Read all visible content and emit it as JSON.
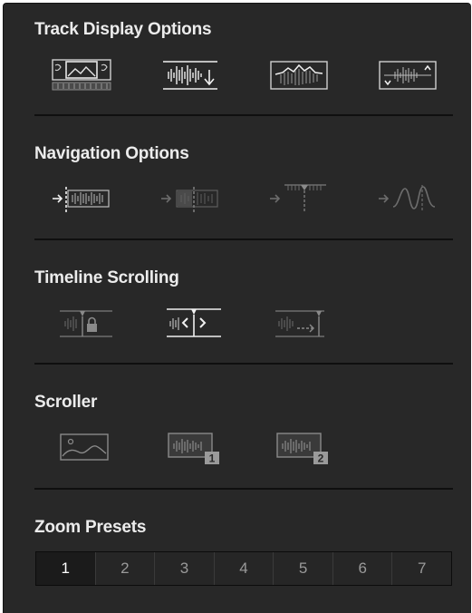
{
  "sections": {
    "track_display": {
      "title": "Track Display Options"
    },
    "navigation": {
      "title": "Navigation Options"
    },
    "timeline_scrolling": {
      "title": "Timeline Scrolling"
    },
    "scroller": {
      "title": "Scroller"
    },
    "zoom_presets": {
      "title": "Zoom Presets"
    }
  },
  "zoom_presets": {
    "selected": "1",
    "buttons": [
      "1",
      "2",
      "3",
      "4",
      "5",
      "6",
      "7"
    ]
  },
  "scroller_badges": [
    "1",
    "2"
  ],
  "colors": {
    "panel_bg": "#282828",
    "title_text": "#ececec",
    "icon_bright": "#e6e6e6",
    "icon_dim": "#6d6d6d",
    "separator": "#0f0f0f"
  }
}
